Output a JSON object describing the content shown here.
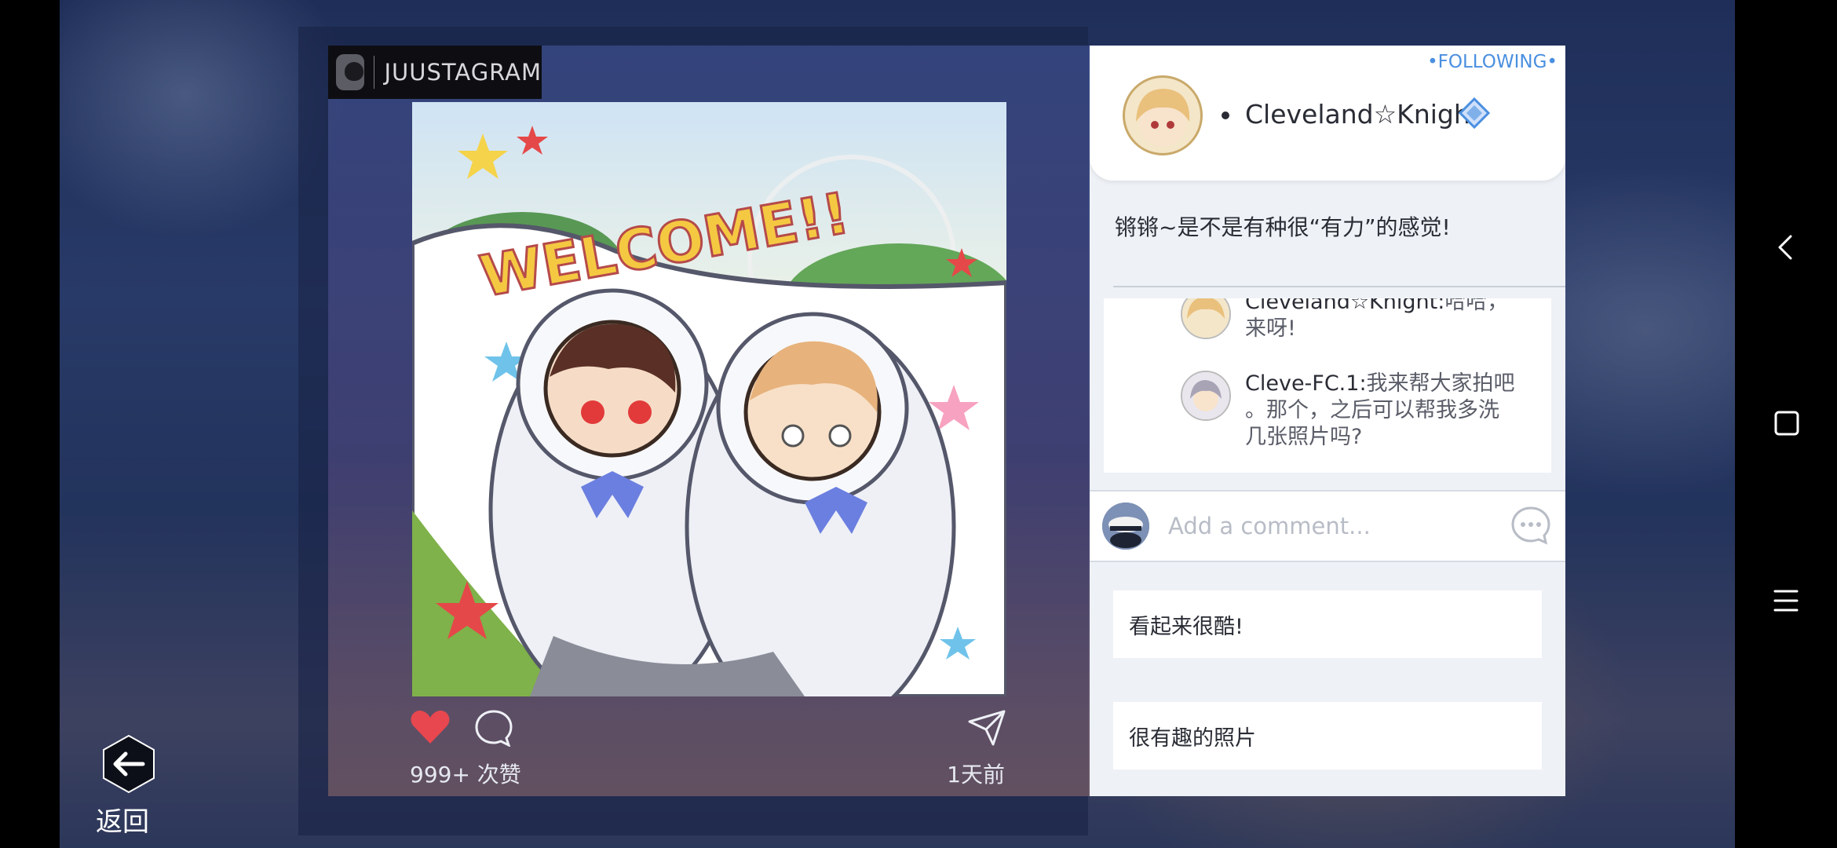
{
  "app": {
    "brand_name": "JUUSTAGRAM"
  },
  "post": {
    "likes_text": "999+ 次赞",
    "time_text": "1天前",
    "image_title": "WELCOME!!"
  },
  "author": {
    "following_label": "•FOLLOWING•",
    "name": "Cleveland☆Knight",
    "caption": "锵锵~是不是有种很“有力”的感觉!"
  },
  "comments": [
    {
      "user": "Cleveland☆Knight:",
      "text_line1": "哈哈，",
      "text_line2": "来呀!"
    },
    {
      "user": "Cleve-FC.1:",
      "text_line1": "我来帮大家拍吧",
      "text_line2": "。那个，之后可以帮我多洗",
      "text_line3": "几张照片吗?"
    }
  ],
  "comment_input": {
    "placeholder": "Add a comment..."
  },
  "quick_replies": [
    "看起来很酷!",
    "很有趣的照片"
  ],
  "back": {
    "label": "返回"
  },
  "colors": {
    "accent": "#4a8fe0",
    "heart": "#e8474f"
  }
}
